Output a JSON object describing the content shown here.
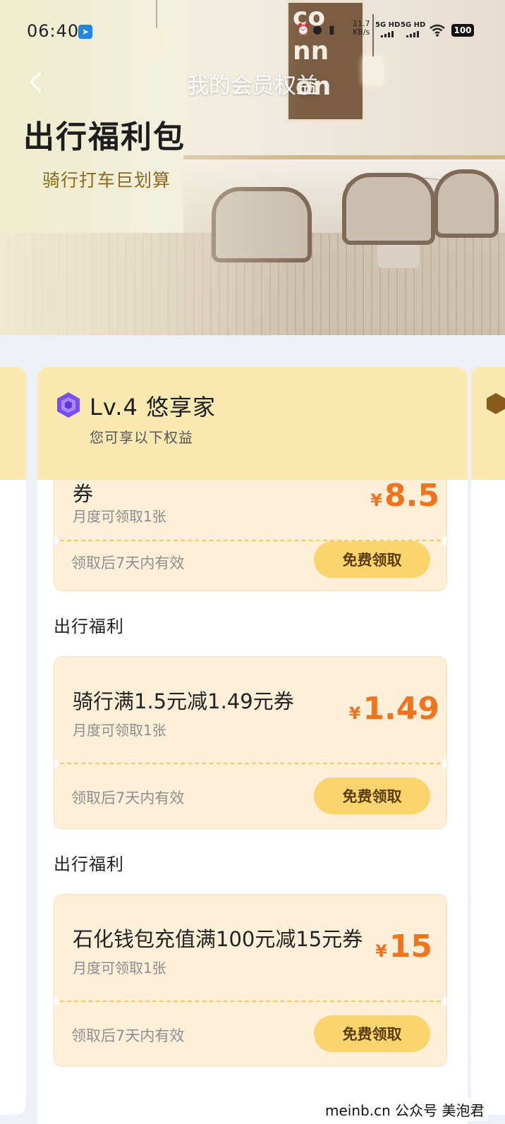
{
  "status_bar": {
    "time": "06:40",
    "net_speed_value": "11.7",
    "net_speed_unit": "KB/s",
    "signal1": "5G HD",
    "signal2": "5G HD",
    "battery": "100"
  },
  "nav": {
    "title": "我的会员权益"
  },
  "hero": {
    "title": "出行福利包",
    "subtitle": "骑行打车巨划算"
  },
  "level_card": {
    "title": "Lv.4 悠享家",
    "subtitle": "您可享以下权益"
  },
  "coupons": [
    {
      "name": "券",
      "limit": "月度可领取1张",
      "price": "8.5",
      "currency": "¥",
      "validity": "领取后7天内有效",
      "button": "免费领取"
    },
    {
      "section": "出行福利",
      "name": "骑行满1.5元减1.49元券",
      "limit": "月度可领取1张",
      "price": "1.49",
      "currency": "¥",
      "validity": "领取后7天内有效",
      "button": "免费领取"
    },
    {
      "section": "出行福利",
      "name": "石化钱包充值满100元减15元券",
      "limit": "月度可领取1张",
      "price": "15",
      "currency": "¥",
      "validity": "领取后7天内有效",
      "button": "免费领取"
    }
  ],
  "watermark": "meinb.cn  公众号 美泡君",
  "colors": {
    "accent": "#f2731c",
    "button": "#fad56e",
    "card_header": "#fbe9b2",
    "coupon_bg": "#fef0d8"
  }
}
